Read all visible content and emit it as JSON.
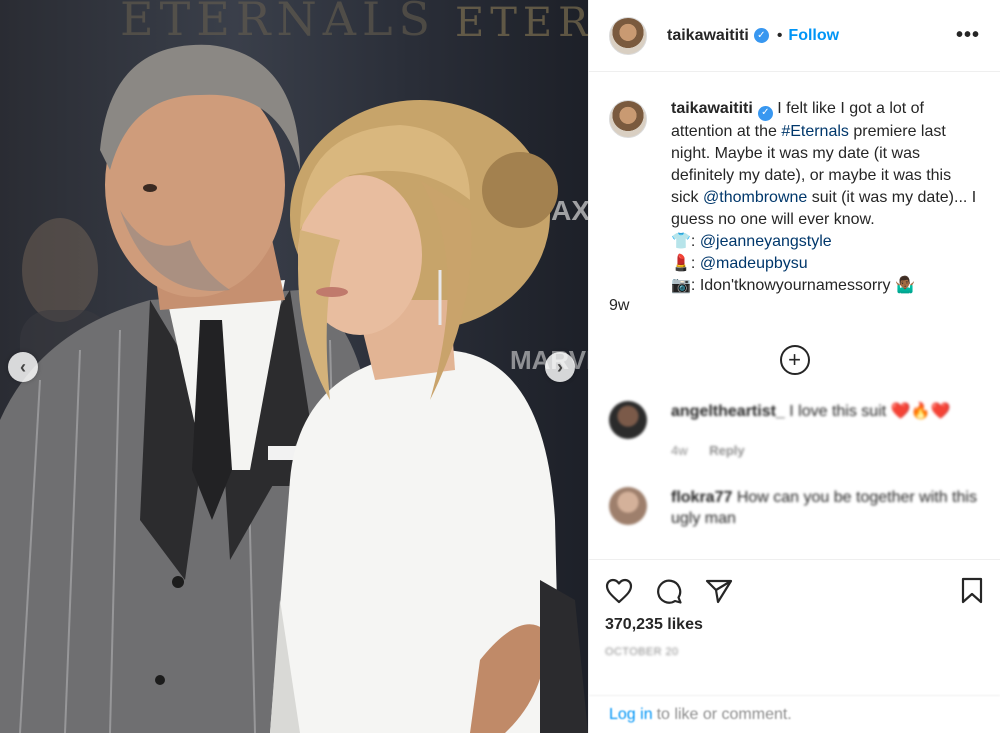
{
  "header": {
    "username": "taikawaititi",
    "verified_icon": "✓",
    "dot": "•",
    "follow_label": "Follow",
    "more_label": "•••"
  },
  "media": {
    "backdrop_text_1": "ETERNALS",
    "backdrop_text_2": "ETER",
    "backdrop_text_3": "iMAX",
    "backdrop_text_4": "MARVEL",
    "prev_icon": "‹",
    "next_icon": "›"
  },
  "caption": {
    "username": "taikawaititi",
    "text_1": " I felt like I got a lot of attention at the ",
    "hashtag": "#Eternals",
    "text_2": " premiere last night. Maybe it was my date (it was definitely my date), or maybe it was this sick ",
    "mention_1": "@thombrowne",
    "text_3": " suit (it was my date)... I guess no one will ever know.",
    "line_shirt_emoji": "👕",
    "line_shirt_sep": ": ",
    "mention_2": "@jeanneyangstyle",
    "line_lipstick_emoji": "💄",
    "line_lipstick_sep": ": ",
    "mention_3": "@madeupbysu",
    "line_camera_emoji": "📷",
    "line_camera_text": ": Idon'tknowyournamessorry ",
    "line_camera_tail_emoji": "🤷🏾‍♂️",
    "time": "9w"
  },
  "load_more_icon": "+",
  "comments": [
    {
      "user": "angeltheartist_",
      "text": " I love this suit ❤️🔥❤️",
      "age": "4w",
      "reply": "Reply"
    },
    {
      "user": "flokra77",
      "text": " How can you be together with this ugly man",
      "age": "",
      "reply": ""
    }
  ],
  "actions": {
    "like_icon": "heart-icon",
    "comment_icon": "comment-icon",
    "share_icon": "share-icon",
    "save_icon": "bookmark-icon"
  },
  "likes": "370,235 likes",
  "date": "OCTOBER 20",
  "login": {
    "link": "Log in",
    "text": "to like or comment."
  }
}
